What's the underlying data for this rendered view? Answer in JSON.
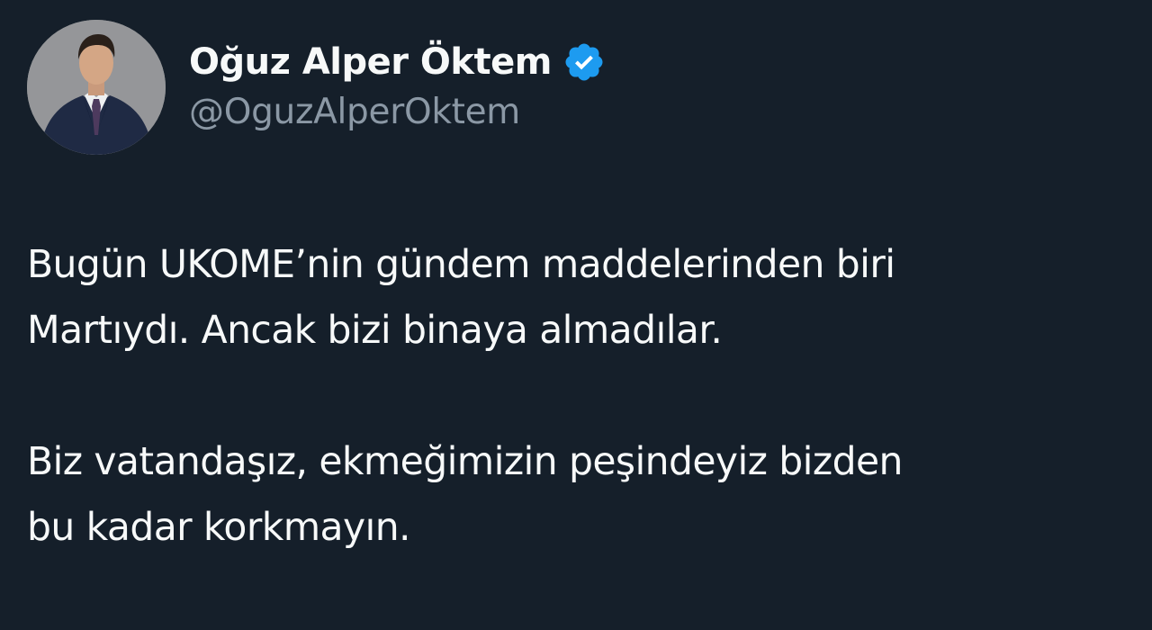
{
  "author": {
    "display_name": "Oğuz Alper Öktem",
    "handle": "@OguzAlperOktem",
    "verified": true,
    "avatar_icon": "profile-photo"
  },
  "tweet": {
    "paragraphs": [
      "Bugün UKOME’nin gündem maddelerinden biri\nMartıydı. Ancak bizi binaya almadılar.",
      "Biz vatandaşız, ekmeğimizin peşindeyiz bizden\nbu kadar korkmayın."
    ]
  },
  "colors": {
    "background": "#151f2a",
    "name": "#f7f9f9",
    "handle": "#8b98a5",
    "verified_badge": "#1d9bf0"
  }
}
